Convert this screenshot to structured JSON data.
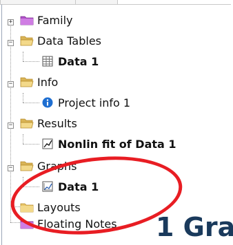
{
  "tree": {
    "items": [
      {
        "label": "Family",
        "expander": "+",
        "icon": "folder-icon"
      },
      {
        "label": "Data Tables",
        "expander": "−",
        "icon": "folder-open-icon"
      },
      {
        "label": "Data 1",
        "icon": "data-table-icon"
      },
      {
        "label": "Info",
        "expander": "−",
        "icon": "folder-open-icon"
      },
      {
        "label": "Project info 1",
        "icon": "info-icon"
      },
      {
        "label": "Results",
        "expander": "−",
        "icon": "folder-open-icon"
      },
      {
        "label": "Nonlin fit of Data 1",
        "icon": "results-icon"
      },
      {
        "label": "Graphs",
        "expander": "−",
        "icon": "folder-open-icon"
      },
      {
        "label": "Data 1",
        "icon": "graph-icon"
      },
      {
        "label": "Layouts",
        "icon": "folder-icon"
      },
      {
        "label": "Floating Notes",
        "icon": "folder-icon"
      }
    ]
  },
  "overlay": {
    "title_fragment": "1 Gra"
  },
  "colors": {
    "folder": "#e8c66a",
    "folder_outline": "#b68b2a",
    "purple_folder": "#b04fc8",
    "info": "#1f6fd1",
    "annotation_red": "#e81d23"
  }
}
